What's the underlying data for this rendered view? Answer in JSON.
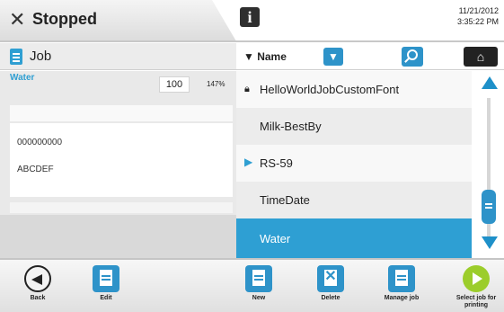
{
  "status": {
    "text": "Stopped",
    "icon": "stop-x-icon"
  },
  "datetime": {
    "date": "11/21/2012",
    "time": "3:35:22 PM"
  },
  "job_panel": {
    "title": "Job",
    "field_name": "Water",
    "field_value": "100",
    "field_percent": "147%",
    "preview_lines": [
      "000000000",
      "ABCDEF"
    ]
  },
  "sort": {
    "label": "▼ Name"
  },
  "job_list": [
    {
      "name": "HelloWorldJobCustomFont",
      "locked": true
    },
    {
      "name": "Milk-BestBy"
    },
    {
      "name": "RS-59",
      "active": true
    },
    {
      "name": "TimeDate"
    },
    {
      "name": "Water",
      "selected": true
    }
  ],
  "toolbar": {
    "back": "Back",
    "edit": "Edit",
    "new": "New",
    "delete": "Delete",
    "manage": "Manage job",
    "select": "Select job for printing"
  },
  "colors": {
    "accent": "#2e9fd3",
    "select_green": "#9ccd2b"
  }
}
